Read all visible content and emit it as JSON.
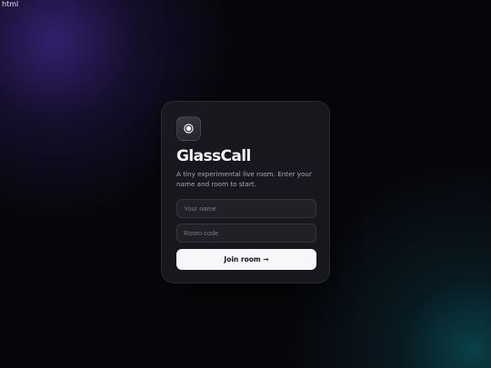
{
  "stray_text": "html",
  "app": {
    "icon": "record-icon",
    "title": "GlassCall",
    "subtitle": "A tiny experimental live room. Enter your name and room to start."
  },
  "form": {
    "name_placeholder": "Your name",
    "name_value": "",
    "room_placeholder": "Room code",
    "room_value": "",
    "join_label": "Join room →"
  },
  "colors": {
    "background": "#07070b",
    "glow_purple": "#5834be",
    "glow_teal": "#0c6e78",
    "button_bg": "#f7f7f9",
    "button_text": "#15151b"
  }
}
